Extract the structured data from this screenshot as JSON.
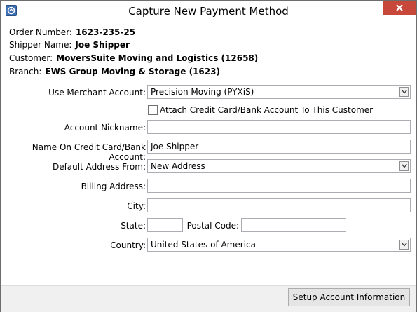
{
  "window": {
    "title": "Capture New Payment Method",
    "close_icon": "close-icon",
    "app_icon": "app-icon"
  },
  "info": {
    "order_number_label": "Order Number:",
    "order_number_value": "1623-235-25",
    "shipper_name_label": "Shipper Name:",
    "shipper_name_value": "Joe Shipper",
    "customer_label": "Customer:",
    "customer_value": "MoversSuite Moving and Logistics (12658)",
    "branch_label": "Branch:",
    "branch_value": "EWS Group Moving & Storage (1623)"
  },
  "form": {
    "merchant_account_label": "Use Merchant Account:",
    "merchant_account_value": "Precision Moving (PYXiS)",
    "attach_checkbox_label": "Attach Credit Card/Bank Account To This Customer",
    "attach_checked": false,
    "account_nickname_label": "Account Nickname:",
    "account_nickname_value": "",
    "name_on_card_label": "Name On Credit Card/Bank Account:",
    "name_on_card_value": "Joe Shipper",
    "default_address_label": "Default Address From:",
    "default_address_value": "New Address",
    "billing_address_label": "Billing Address:",
    "billing_address_value": "",
    "city_label": "City:",
    "city_value": "",
    "state_label": "State:",
    "state_value": "",
    "postal_code_label": "Postal Code:",
    "postal_code_value": "",
    "country_label": "Country:",
    "country_value": "United States of America"
  },
  "footer": {
    "setup_button_label": "Setup Account Information"
  }
}
